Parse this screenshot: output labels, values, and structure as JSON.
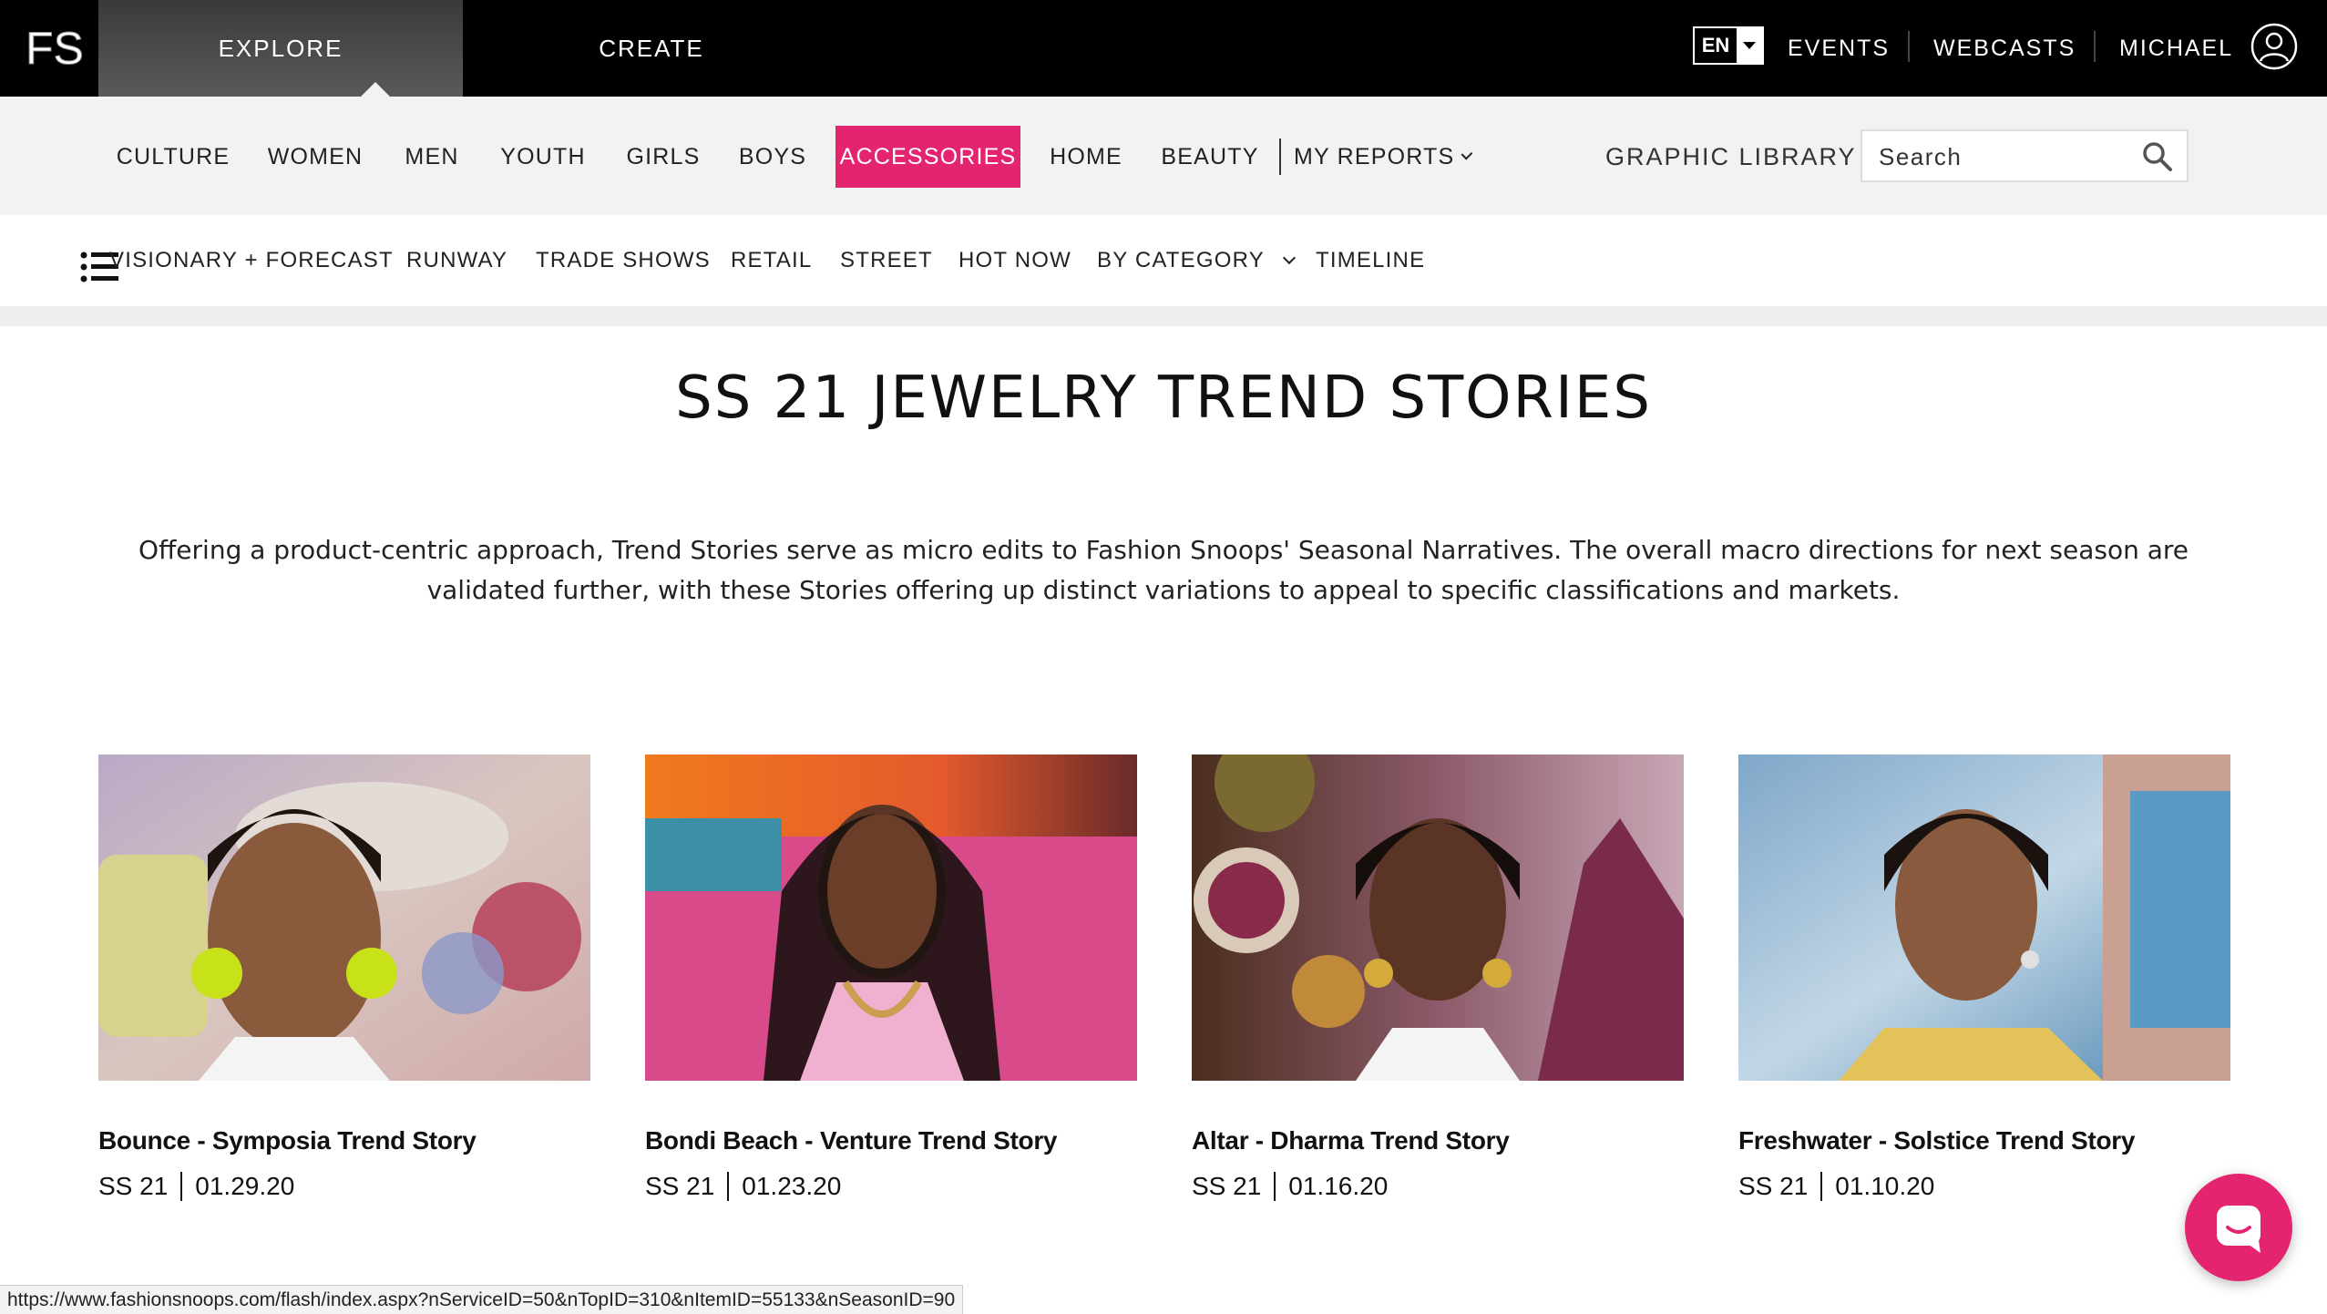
{
  "topbar": {
    "logo_text": "FS",
    "tabs": [
      {
        "label": "EXPLORE",
        "active": true
      },
      {
        "label": "CREATE",
        "active": false
      }
    ],
    "language": "EN",
    "links": [
      "EVENTS",
      "WEBCASTS",
      "MICHAEL"
    ],
    "user_icon": "user-circle-icon"
  },
  "categories": {
    "items": [
      "CULTURE",
      "WOMEN",
      "MEN",
      "YOUTH",
      "GIRLS",
      "BOYS",
      "ACCESSORIES",
      "HOME",
      "BEAUTY"
    ],
    "active": "ACCESSORIES",
    "my_reports": "MY REPORTS",
    "graphic_library": "GRAPHIC LIBRARY",
    "search_placeholder": "Search",
    "accent_color": "#e5246f"
  },
  "subnav": {
    "menu_icon": "list-menu-icon",
    "items": [
      "VISIONARY + FORECAST",
      "RUNWAY",
      "TRADE SHOWS",
      "RETAIL",
      "STREET",
      "HOT NOW",
      "BY CATEGORY",
      "TIMELINE"
    ]
  },
  "page": {
    "title": "SS 21 JEWELRY TREND STORIES",
    "intro": "Offering a product-centric approach, Trend Stories serve as micro edits to Fashion Snoops' Seasonal Narratives. The overall macro directions for next season are validated further, with these Stories offering up distinct variations to appeal to specific classifications and markets."
  },
  "cards": [
    {
      "title": "Bounce - Symposia Trend Story",
      "season": "SS 21",
      "date": "01.29.20"
    },
    {
      "title": "Bondi Beach - Venture Trend Story",
      "season": "SS 21",
      "date": "01.23.20"
    },
    {
      "title": "Altar - Dharma Trend Story",
      "season": "SS 21",
      "date": "01.16.20"
    },
    {
      "title": "Freshwater - Solstice Trend Story",
      "season": "SS 21",
      "date": "01.10.20"
    }
  ],
  "status_url": "https://www.fashionsnoops.com/flash/index.aspx?nServiceID=50&nTopID=310&nItemID=55133&nSeasonID=90",
  "chat_icon": "chat-bubble-icon"
}
